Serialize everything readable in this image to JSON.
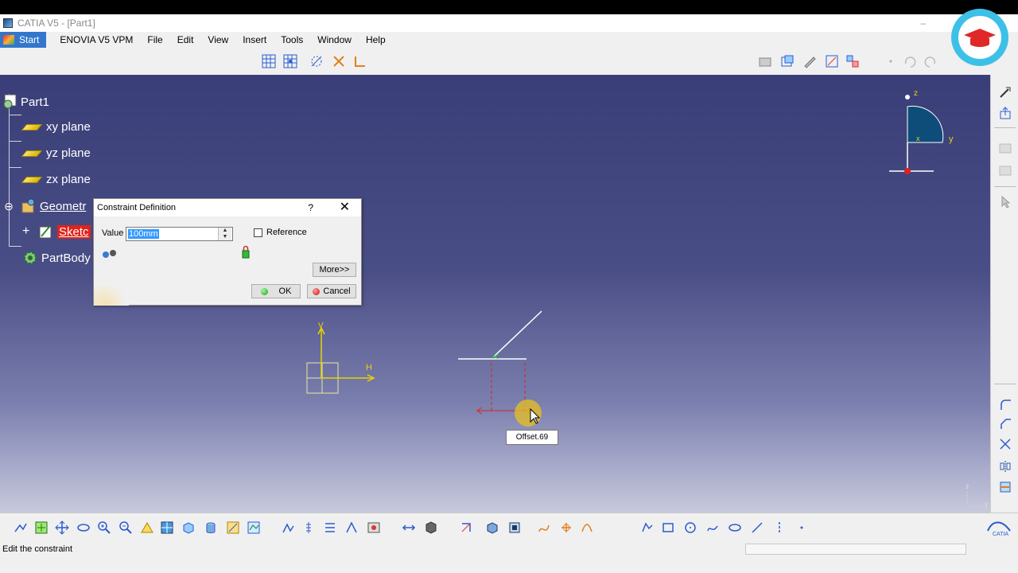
{
  "window": {
    "title": "CATIA V5 - [Part1]"
  },
  "menu": {
    "start": "Start",
    "items": [
      "ENOVIA V5 VPM",
      "File",
      "Edit",
      "View",
      "Insert",
      "Tools",
      "Window",
      "Help"
    ]
  },
  "tree": {
    "root": "Part1",
    "nodes": [
      {
        "label": "xy plane"
      },
      {
        "label": "yz plane"
      },
      {
        "label": "zx plane"
      },
      {
        "label": "Geometr"
      },
      {
        "label": "Sketc"
      },
      {
        "label": "PartBody"
      }
    ]
  },
  "dialog": {
    "title": "Constraint Definition",
    "help": "?",
    "close": "✕",
    "value_label": "Value",
    "value": "100mm",
    "reference_label": "Reference",
    "reference_checked": false,
    "more_label": "More>>",
    "ok_label": "OK",
    "cancel_label": "Cancel"
  },
  "sketch": {
    "v_label": "V",
    "h_label": "H",
    "tooltip": "Offset.69"
  },
  "compass": {
    "z": "z",
    "y": "y",
    "x": "x"
  },
  "status": {
    "message": "Edit the constraint"
  },
  "colors": {
    "viewport_top": "#3a3e78",
    "viewport_bottom": "#c7c9dd",
    "accent": "#3377cc"
  }
}
